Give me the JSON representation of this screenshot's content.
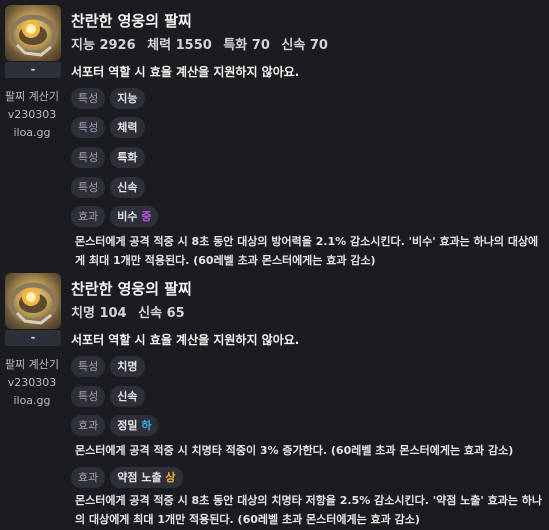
{
  "items": [
    {
      "title": "찬란한 영웅의 팔찌",
      "stats": [
        "지능 2926",
        "체력 1550",
        "특화 70",
        "신속 70"
      ],
      "tier": "-",
      "meta": [
        "팔찌 계산기",
        "v230303",
        "iloa.gg"
      ],
      "notice": "서포터 역할 시 효율 계산을 지원하지 않아요.",
      "options": [
        {
          "tag": "특성",
          "value": "지능"
        },
        {
          "tag": "특성",
          "value": "체력"
        },
        {
          "tag": "특성",
          "value": "특화"
        },
        {
          "tag": "특성",
          "value": "신속"
        }
      ],
      "effects": [
        {
          "tag": "효과",
          "name": "비수",
          "grade": "중",
          "grade_color": "#c050f0",
          "desc": "몬스터에게 공격 적중 시 8초 동안 대상의 방어력을 2.1% 감소시킨다. '비수' 효과는 하나의 대상에게 최대 1개만 적용된다. (60레벨 초과 몬스터에게는 효과 감소)"
        }
      ]
    },
    {
      "title": "찬란한 영웅의 팔찌",
      "stats": [
        "치명 104",
        "신속 65"
      ],
      "tier": "-",
      "meta": [
        "팔찌 계산기",
        "v230303",
        "iloa.gg"
      ],
      "notice": "서포터 역할 시 효율 계산을 지원하지 않아요.",
      "options": [
        {
          "tag": "특성",
          "value": "치명"
        },
        {
          "tag": "특성",
          "value": "신속"
        }
      ],
      "effects": [
        {
          "tag": "효과",
          "name": "정밀",
          "grade": "하",
          "grade_color": "#3fa8ef",
          "desc": "몬스터에게 공격 적중 시 치명타 적중이 3% 증가한다. (60레벨 초과 몬스터에게는 효과 감소)"
        },
        {
          "tag": "효과",
          "name": "약점 노출",
          "grade": "상",
          "grade_color": "#f2b42c",
          "desc": "몬스터에게 공격 적중 시 8초 동안 대상의 치명타 저항을 2.5% 감소시킨다. '약점 노출' 효과는 하나의 대상에게 최대 1개만 적용된다. (60레벨 초과 몬스터에게는 효과 감소)"
        }
      ]
    }
  ]
}
